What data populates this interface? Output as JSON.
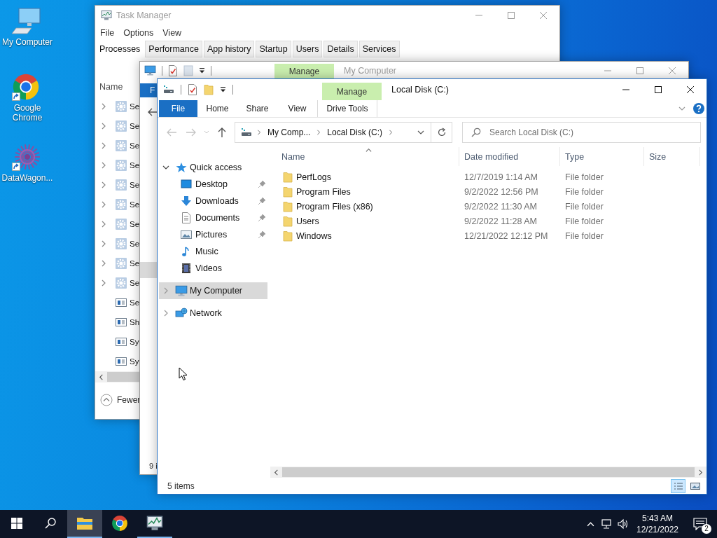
{
  "desktop_icons": [
    {
      "kind": "computer",
      "label": "My Computer",
      "shortcut": false
    },
    {
      "kind": "chrome",
      "label": "Google Chrome",
      "shortcut": true
    },
    {
      "kind": "app",
      "label": "DataWagon...",
      "shortcut": true
    }
  ],
  "task_manager": {
    "title": "Task Manager",
    "menu": [
      "File",
      "Options",
      "View"
    ],
    "tabs": [
      {
        "label": "Processes",
        "selected": true
      },
      {
        "label": "Performance",
        "selected": false
      },
      {
        "label": "App history",
        "selected": false
      },
      {
        "label": "Startup",
        "selected": false
      },
      {
        "label": "Users",
        "selected": false
      },
      {
        "label": "Details",
        "selected": false
      },
      {
        "label": "Services",
        "selected": false
      }
    ],
    "column": "Name",
    "processes": [
      {
        "kind": "service",
        "expandable": true,
        "name": "Se"
      },
      {
        "kind": "service",
        "expandable": true,
        "name": "Se"
      },
      {
        "kind": "service",
        "expandable": true,
        "name": "Se"
      },
      {
        "kind": "service",
        "expandable": true,
        "name": "Se"
      },
      {
        "kind": "service",
        "expandable": true,
        "name": "Se"
      },
      {
        "kind": "service",
        "expandable": true,
        "name": "Se"
      },
      {
        "kind": "service",
        "expandable": true,
        "name": "Se"
      },
      {
        "kind": "service",
        "expandable": true,
        "name": "Se"
      },
      {
        "kind": "service",
        "expandable": true,
        "name": "Se"
      },
      {
        "kind": "service",
        "expandable": true,
        "name": "Se"
      },
      {
        "kind": "window",
        "expandable": false,
        "name": "Se"
      },
      {
        "kind": "window",
        "expandable": false,
        "name": "Sh"
      },
      {
        "kind": "window",
        "expandable": false,
        "name": "Sy"
      },
      {
        "kind": "window",
        "expandable": false,
        "name": "Sy"
      }
    ],
    "footer": "Fewer"
  },
  "back_explorer": {
    "title": "My Computer",
    "context_tab": "Manage",
    "file_tab": "F",
    "nav_row": {
      "selected": true
    },
    "status": "9 i"
  },
  "explorer": {
    "title": "Local Disk (C:)",
    "context_tab": "Manage",
    "ribbon_tabs": [
      {
        "label": "File",
        "kind": "file"
      },
      {
        "label": "Home",
        "kind": "tab"
      },
      {
        "label": "Share",
        "kind": "tab"
      },
      {
        "label": "View",
        "kind": "tab"
      },
      {
        "label": "Drive Tools",
        "kind": "context"
      }
    ],
    "breadcrumbs": [
      "My Comp...",
      "Local Disk (C:)"
    ],
    "search": {
      "placeholder": "Search Local Disk (C:)"
    },
    "nav": [
      {
        "kind": "star",
        "label": "Quick access",
        "expanded": true,
        "selected": false,
        "children": [
          {
            "kind": "desktop",
            "label": "Desktop",
            "pinned": true
          },
          {
            "kind": "downloads",
            "label": "Downloads",
            "pinned": true
          },
          {
            "kind": "documents",
            "label": "Documents",
            "pinned": true
          },
          {
            "kind": "pictures",
            "label": "Pictures",
            "pinned": true
          },
          {
            "kind": "music",
            "label": "Music",
            "pinned": false
          },
          {
            "kind": "videos",
            "label": "Videos",
            "pinned": false
          }
        ]
      },
      {
        "kind": "computer",
        "label": "My Computer",
        "expanded": false,
        "selected": true
      },
      {
        "kind": "network",
        "label": "Network",
        "expanded": false,
        "selected": false
      }
    ],
    "columns": [
      "Name",
      "Date modified",
      "Type",
      "Size"
    ],
    "files": [
      {
        "name": "PerfLogs",
        "date": "12/7/2019 1:14 AM",
        "type": "File folder"
      },
      {
        "name": "Program Files",
        "date": "9/2/2022 12:56 PM",
        "type": "File folder"
      },
      {
        "name": "Program Files (x86)",
        "date": "9/2/2022 11:30 AM",
        "type": "File folder"
      },
      {
        "name": "Users",
        "date": "9/2/2022 11:28 AM",
        "type": "File folder"
      },
      {
        "name": "Windows",
        "date": "12/21/2022 12:12 PM",
        "type": "File folder"
      }
    ],
    "status": "5 items",
    "views": [
      {
        "kind": "details",
        "selected": true
      },
      {
        "kind": "large",
        "selected": false
      }
    ]
  },
  "taskbar": {
    "apps": [
      {
        "kind": "explorer",
        "active": true,
        "running": true
      },
      {
        "kind": "chrome",
        "active": false,
        "running": false
      },
      {
        "kind": "taskmgr",
        "active": false,
        "running": true
      }
    ],
    "time": "5:43 AM",
    "date": "12/21/2022",
    "notifications": "2"
  }
}
